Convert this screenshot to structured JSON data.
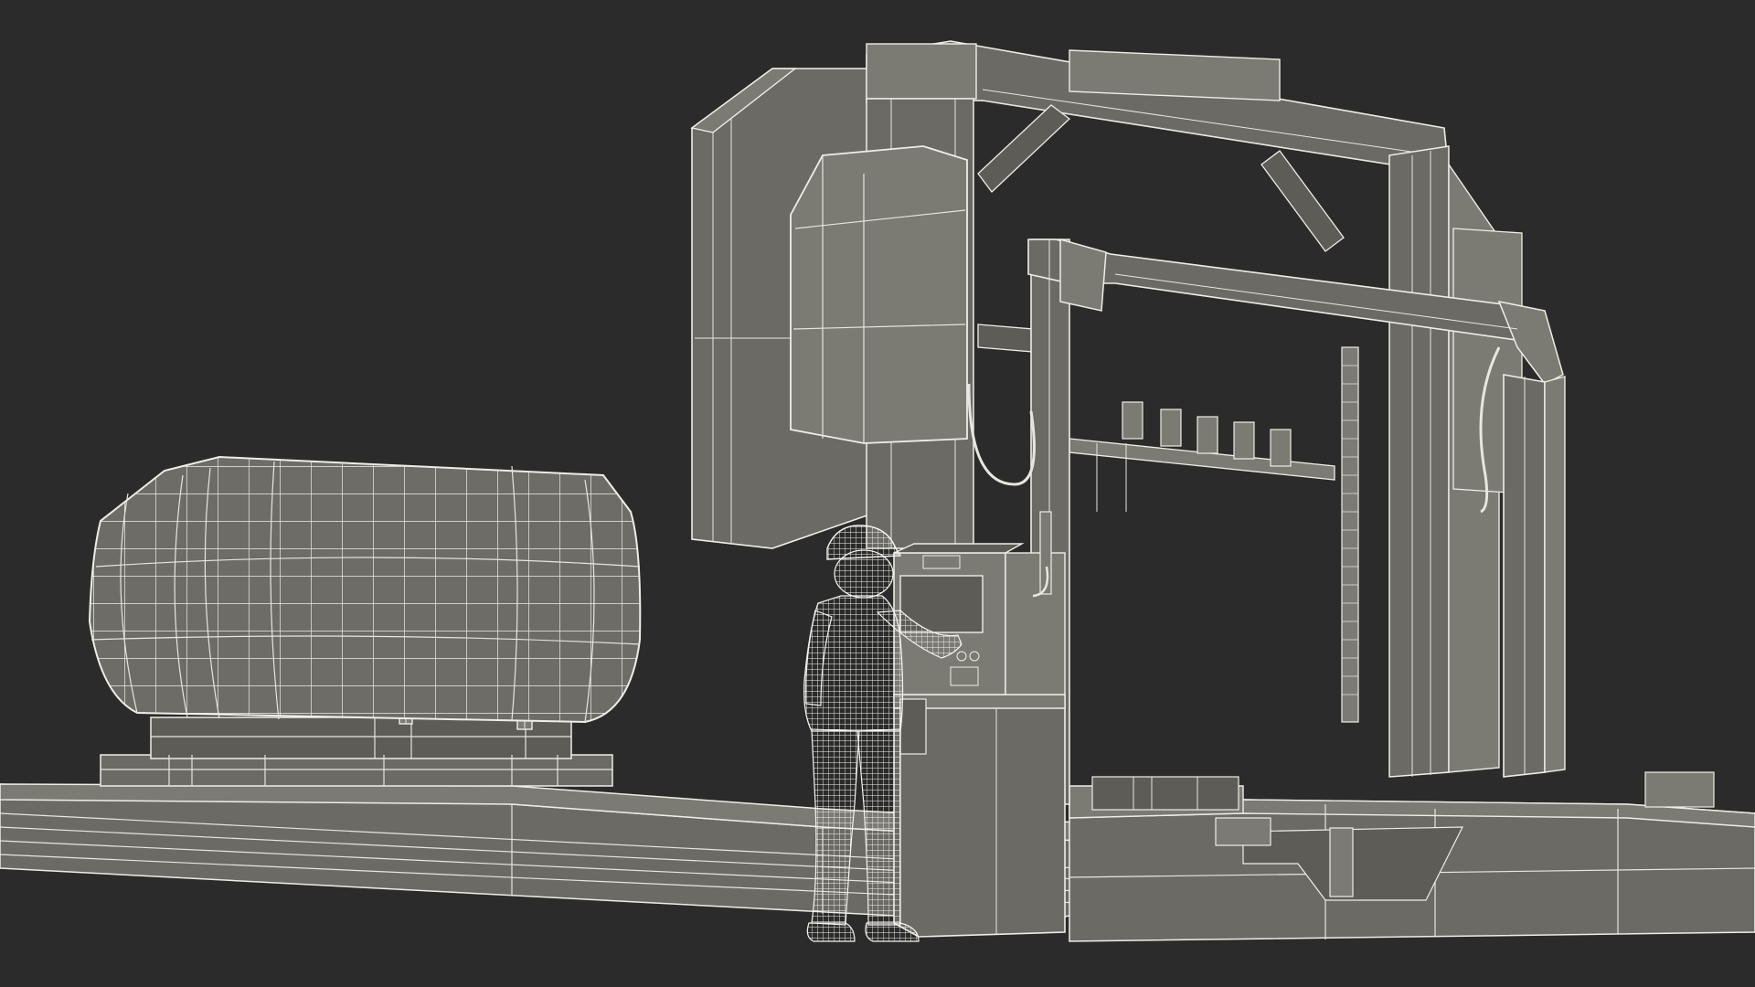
{
  "scene": {
    "background": "#2b2b2b",
    "wire_color": "#e8e6df",
    "surface_color": "#6b6a64",
    "objects": [
      {
        "name": "log",
        "icon": "log-wireframe"
      },
      {
        "name": "log-carriage",
        "icon": "carriage-wireframe"
      },
      {
        "name": "rail-track",
        "icon": "rail-wireframe"
      },
      {
        "name": "bandsaw-gantry",
        "icon": "gantry-wireframe"
      },
      {
        "name": "control-console",
        "icon": "console-wireframe"
      },
      {
        "name": "operator",
        "icon": "person-wireframe"
      }
    ]
  }
}
